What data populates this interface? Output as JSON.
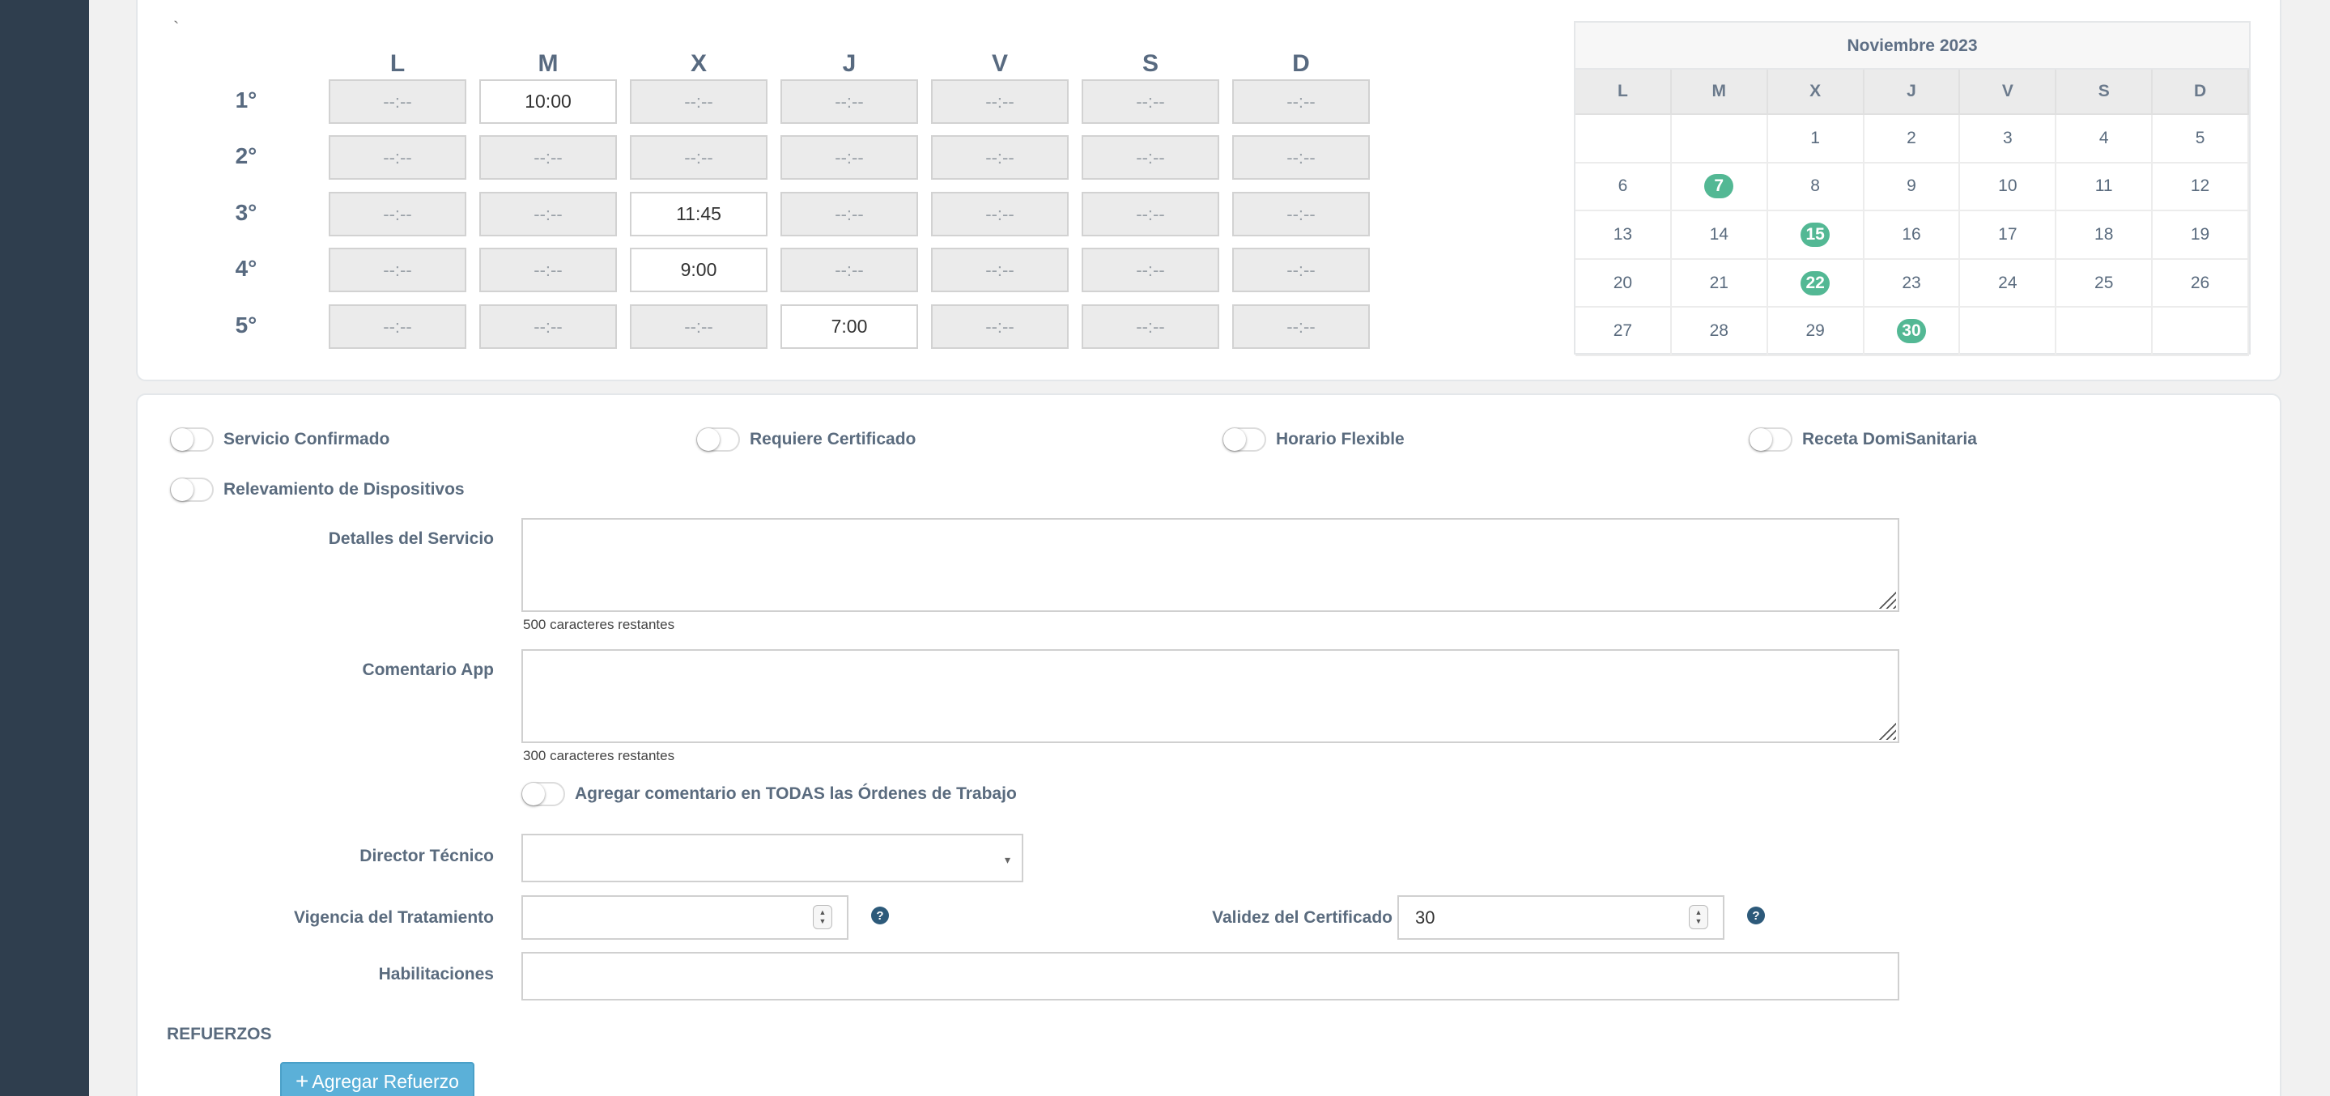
{
  "schedule": {
    "days": [
      "L",
      "M",
      "X",
      "J",
      "V",
      "S",
      "D"
    ],
    "slots": [
      {
        "label": "1°",
        "times": [
          "--:--",
          "10:00",
          "--:--",
          "--:--",
          "--:--",
          "--:--",
          "--:--"
        ]
      },
      {
        "label": "2°",
        "times": [
          "--:--",
          "--:--",
          "--:--",
          "--:--",
          "--:--",
          "--:--",
          "--:--"
        ]
      },
      {
        "label": "3°",
        "times": [
          "--:--",
          "--:--",
          "11:45",
          "--:--",
          "--:--",
          "--:--",
          "--:--"
        ]
      },
      {
        "label": "4°",
        "times": [
          "--:--",
          "--:--",
          "9:00",
          "--:--",
          "--:--",
          "--:--",
          "--:--"
        ]
      },
      {
        "label": "5°",
        "times": [
          "--:--",
          "--:--",
          "--:--",
          "7:00",
          "--:--",
          "--:--",
          "--:--"
        ]
      }
    ],
    "filled": [
      [
        0,
        1
      ],
      [
        2,
        2
      ],
      [
        3,
        2
      ],
      [
        4,
        3
      ]
    ]
  },
  "calendar": {
    "title": "Noviembre 2023",
    "weekdays": [
      "L",
      "M",
      "X",
      "J",
      "V",
      "S",
      "D"
    ],
    "weeks": [
      [
        "",
        "",
        "1",
        "2",
        "3",
        "4",
        "5"
      ],
      [
        "6",
        "7",
        "8",
        "9",
        "10",
        "11",
        "12"
      ],
      [
        "13",
        "14",
        "15",
        "16",
        "17",
        "18",
        "19"
      ],
      [
        "20",
        "21",
        "22",
        "23",
        "24",
        "25",
        "26"
      ],
      [
        "27",
        "28",
        "29",
        "30",
        "",
        "",
        ""
      ]
    ],
    "highlighted": [
      "7",
      "15",
      "22",
      "30"
    ],
    "highlight_color": "#53b894"
  },
  "toggles": [
    {
      "label": "Servicio Confirmado",
      "on": false
    },
    {
      "label": "Requiere Certificado",
      "on": false
    },
    {
      "label": "Horario Flexible",
      "on": false
    },
    {
      "label": "Receta DomiSanitaria",
      "on": false
    },
    {
      "label": "Relevamiento de Dispositivos",
      "on": false
    }
  ],
  "form": {
    "detalles_label": "Detalles del Servicio",
    "detalles_value": "",
    "detalles_counter": "500 caracteres restantes",
    "comentario_label": "Comentario App",
    "comentario_value": "",
    "comentario_counter": "300 caracteres restantes",
    "agregar_toggle_label": "Agregar comentario en TODAS las Órdenes de Trabajo",
    "director_label": "Director Técnico",
    "director_value": "",
    "vigencia_label": "Vigencia del Tratamiento",
    "vigencia_value": "",
    "validez_label": "Validez del Certificado",
    "validez_value": "30",
    "habilitaciones_label": "Habilitaciones",
    "habilitaciones_value": "",
    "help_glyph": "?",
    "caret_glyph": "▾"
  },
  "refuerzos": {
    "title": "REFUERZOS",
    "add_button_icon": "+",
    "add_button_label": "Agregar Refuerzo"
  },
  "misc": {
    "tick": "`"
  },
  "colors": {
    "sidebar": "#2f3e4e",
    "accent_button": "#5bb0d8",
    "help_icon": "#2d5a7a"
  }
}
